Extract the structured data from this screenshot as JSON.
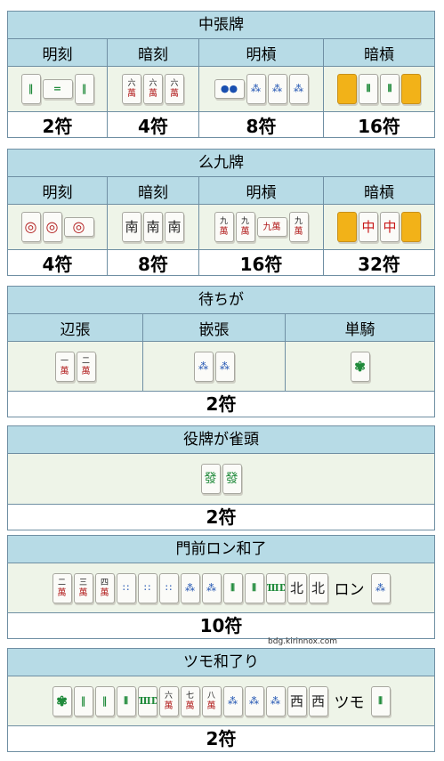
{
  "credit": "bdg.kirinnox.com",
  "s1": {
    "title": "中張牌",
    "cols": [
      "明刻",
      "暗刻",
      "明槓",
      "暗槓"
    ],
    "points": [
      "2符",
      "4符",
      "8符",
      "16符"
    ]
  },
  "s2": {
    "title": "么九牌",
    "cols": [
      "明刻",
      "暗刻",
      "明槓",
      "暗槓"
    ],
    "points": [
      "4符",
      "8符",
      "16符",
      "32符"
    ],
    "tiles": {
      "nan": "南",
      "chun": "中",
      "jiu": "九",
      "wan": "萬"
    }
  },
  "s3": {
    "title": "待ちが",
    "cols": [
      "辺張",
      "嵌張",
      "単騎"
    ],
    "points": "2符",
    "tiles": {
      "yi": "一",
      "er": "二",
      "wan": "萬"
    }
  },
  "s4": {
    "title": "役牌が雀頭",
    "points": "2符",
    "tiles": {
      "hatsu": "發"
    }
  },
  "s5": {
    "title": "門前ロン和了",
    "points": "10符",
    "word": "ロン",
    "tiles": {
      "er": "二",
      "san": "三",
      "si": "四",
      "wan": "萬",
      "bei": "北"
    }
  },
  "s6": {
    "title": "ツモ和了り",
    "points": "2符",
    "word": "ツモ",
    "tiles": {
      "liu": "六",
      "qi": "七",
      "ba": "八",
      "wan": "萬",
      "xi": "西"
    }
  }
}
